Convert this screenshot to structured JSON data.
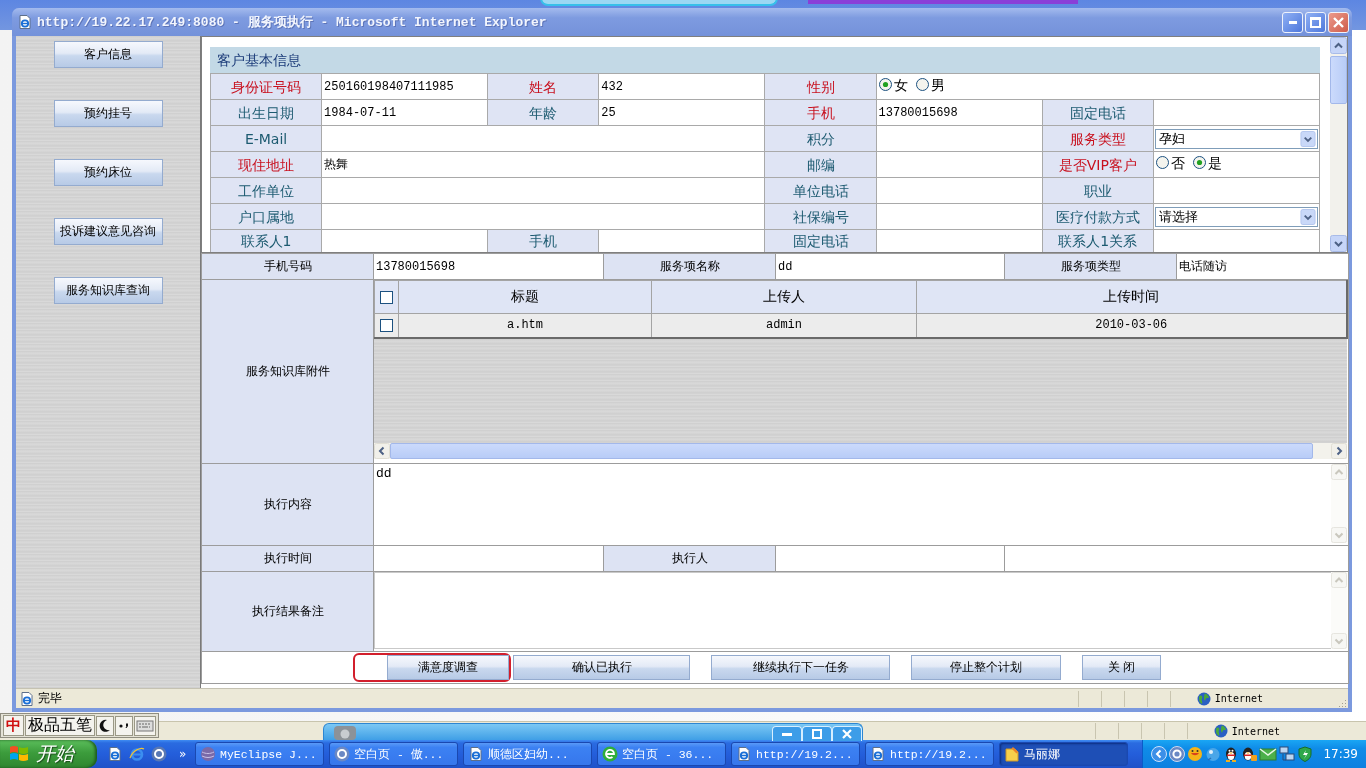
{
  "background_window": {
    "zone": "Internet"
  },
  "window": {
    "title": "http://19.22.17.249:8080 - 服务项执行 - Microsoft Internet Explorer"
  },
  "sidebar": {
    "items": [
      {
        "label": "客户信息"
      },
      {
        "label": "预约挂号"
      },
      {
        "label": "预约床位"
      },
      {
        "label": "投诉建议意见咨询"
      },
      {
        "label": "服务知识库查询"
      }
    ]
  },
  "customer_info": {
    "title": "客户基本信息",
    "rows": [
      [
        {
          "kind": "label",
          "text": "身份证号码",
          "required": true
        },
        {
          "kind": "field",
          "value": "250160198407111985"
        },
        {
          "kind": "label",
          "text": "姓名",
          "required": true
        },
        {
          "kind": "field",
          "value": "432"
        },
        {
          "kind": "label",
          "text": "性别",
          "required": true
        },
        {
          "kind": "radio",
          "colspan": 3,
          "options": [
            {
              "label": "女",
              "selected": true
            },
            {
              "label": "男",
              "selected": false
            }
          ]
        }
      ],
      [
        {
          "kind": "label",
          "text": "出生日期",
          "required": false
        },
        {
          "kind": "field",
          "value": "1984-07-11"
        },
        {
          "kind": "label",
          "text": "年龄",
          "required": false
        },
        {
          "kind": "field",
          "value": "25"
        },
        {
          "kind": "label",
          "text": "手机",
          "required": true
        },
        {
          "kind": "field",
          "value": "13780015698"
        },
        {
          "kind": "label",
          "text": "固定电话",
          "required": false
        },
        {
          "kind": "field"
        }
      ],
      [
        {
          "kind": "label",
          "text": "E-Mail",
          "required": false
        },
        {
          "kind": "field",
          "colspan": 3
        },
        {
          "kind": "label",
          "text": "积分",
          "required": false
        },
        {
          "kind": "field"
        },
        {
          "kind": "label",
          "text": "服务类型",
          "required": true
        },
        {
          "kind": "select",
          "value": "孕妇"
        }
      ],
      [
        {
          "kind": "label",
          "text": "现住地址",
          "required": true
        },
        {
          "kind": "field",
          "colspan": 3,
          "value": "热舞"
        },
        {
          "kind": "label",
          "text": "邮编",
          "required": false
        },
        {
          "kind": "field"
        },
        {
          "kind": "label",
          "text": "是否VIP客户",
          "required": true
        },
        {
          "kind": "radio",
          "options": [
            {
              "label": "否",
              "selected": false
            },
            {
              "label": "是",
              "selected": true
            }
          ]
        }
      ],
      [
        {
          "kind": "label",
          "text": "工作单位",
          "required": false
        },
        {
          "kind": "field",
          "colspan": 3
        },
        {
          "kind": "label",
          "text": "单位电话",
          "required": false
        },
        {
          "kind": "field"
        },
        {
          "kind": "label",
          "text": "职业",
          "required": false
        },
        {
          "kind": "field"
        }
      ],
      [
        {
          "kind": "label",
          "text": "户口属地",
          "required": false
        },
        {
          "kind": "field",
          "colspan": 3
        },
        {
          "kind": "label",
          "text": "社保编号",
          "required": false
        },
        {
          "kind": "field"
        },
        {
          "kind": "label",
          "text": "医疗付款方式",
          "required": false
        },
        {
          "kind": "select",
          "value": "请选择"
        }
      ],
      [
        {
          "kind": "label",
          "text": "联系人1",
          "required": false
        },
        {
          "kind": "field"
        },
        {
          "kind": "label",
          "text": "手机",
          "required": false
        },
        {
          "kind": "field"
        },
        {
          "kind": "label",
          "text": "固定电话",
          "required": false
        },
        {
          "kind": "field"
        },
        {
          "kind": "label",
          "text": "联系人1关系",
          "required": false
        },
        {
          "kind": "field"
        }
      ]
    ]
  },
  "service_form": {
    "info_row": [
      {
        "kind": "label",
        "text": "手机号码"
      },
      {
        "kind": "field",
        "value": "13780015698"
      },
      {
        "kind": "label",
        "text": "服务项名称"
      },
      {
        "kind": "field",
        "value": "dd"
      },
      {
        "kind": "label",
        "text": "服务项类型"
      },
      {
        "kind": "field",
        "value": "电话随访"
      }
    ],
    "attachments": {
      "label": "服务知识库附件",
      "header_checked": false,
      "columns": [
        "标题",
        "上传人",
        "上传时间"
      ],
      "rows": [
        {
          "checked": false,
          "cells": [
            "a.htm",
            "admin",
            "2010-03-06"
          ]
        }
      ]
    },
    "content": {
      "label": "执行内容",
      "value": "dd"
    },
    "time_row": [
      {
        "kind": "label",
        "text": "执行时间"
      },
      {
        "kind": "field"
      },
      {
        "kind": "label",
        "text": "执行人"
      },
      {
        "kind": "field"
      },
      {
        "kind": "field",
        "colspan": 2
      }
    ],
    "remarks": {
      "label": "执行结果备注"
    }
  },
  "buttons": [
    {
      "label": "满意度调查",
      "highlighted": true
    },
    {
      "label": "确认已执行",
      "highlighted": false
    },
    {
      "label": "继续执行下一任务",
      "highlighted": false
    },
    {
      "label": "停止整个计划",
      "highlighted": false
    },
    {
      "label": "关 闭",
      "highlighted": false
    }
  ],
  "status_bar": {
    "text": "完毕",
    "zone": "Internet"
  },
  "ime_bar": {
    "mode": "中",
    "name": "极品五笔"
  },
  "taskbar": {
    "start": "开始",
    "more": "»",
    "tasks": [
      {
        "label": "MyEclipse J...",
        "kind": "sphere",
        "selected": false
      },
      {
        "label": "空白页 - 傲...",
        "kind": "ring",
        "selected": false
      },
      {
        "label": "顺德区妇幼...",
        "kind": "page",
        "selected": false
      },
      {
        "label": "空白页 - 36...",
        "kind": "swirl",
        "selected": false
      },
      {
        "label": "http://19.2...",
        "kind": "page",
        "selected": false
      },
      {
        "label": "http://19.2...",
        "kind": "page",
        "selected": false
      },
      {
        "label": "马丽娜",
        "kind": "note",
        "selected": true
      }
    ],
    "clock": "17:39"
  }
}
